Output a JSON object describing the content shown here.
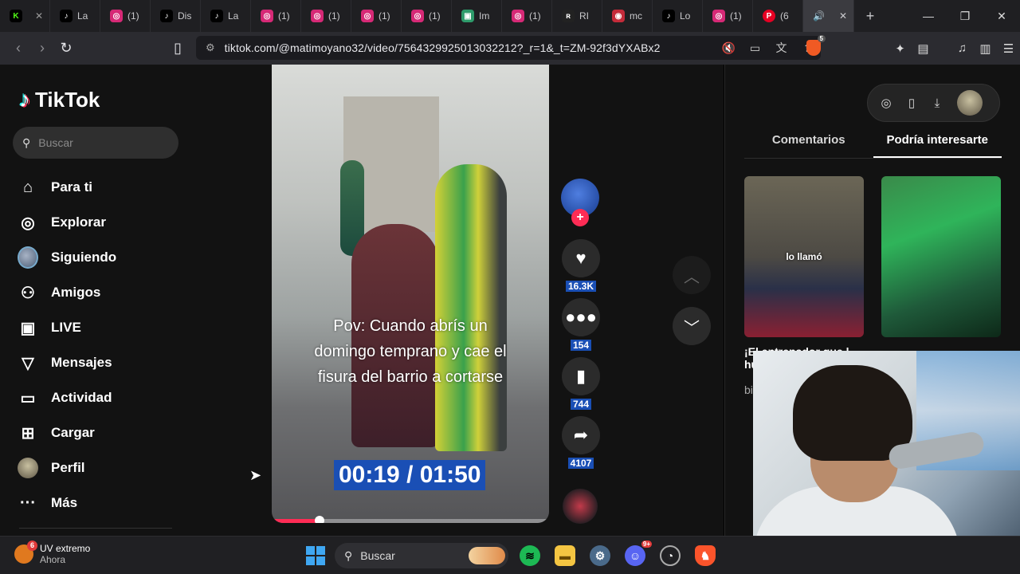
{
  "browser": {
    "tabs": [
      {
        "label": "",
        "icon": "kick-icon",
        "color": "#53fc18"
      },
      {
        "label": "La",
        "icon": "tiktok-icon",
        "color": "#000000"
      },
      {
        "label": "(1)",
        "icon": "instagram-icon",
        "color": "#d62976"
      },
      {
        "label": "Dis",
        "icon": "tiktok-icon",
        "color": "#000000"
      },
      {
        "label": "La",
        "icon": "tiktok-icon",
        "color": "#000000"
      },
      {
        "label": "(1)",
        "icon": "instagram-icon",
        "color": "#d62976"
      },
      {
        "label": "(1)",
        "icon": "instagram-icon",
        "color": "#d62976"
      },
      {
        "label": "(1)",
        "icon": "instagram-icon",
        "color": "#d62976"
      },
      {
        "label": "(1)",
        "icon": "instagram-icon",
        "color": "#d62976"
      },
      {
        "label": "Im",
        "icon": "image-icon",
        "color": "#2e9b6b"
      },
      {
        "label": "(1)",
        "icon": "instagram-icon",
        "color": "#d62976"
      },
      {
        "label": "RI",
        "icon": "rhythm-icon",
        "color": "#222222"
      },
      {
        "label": "mc",
        "icon": "target-icon",
        "color": "#c42b3a"
      },
      {
        "label": "Lo",
        "icon": "tiktok-icon",
        "color": "#000000"
      },
      {
        "label": "(1)",
        "icon": "instagram-icon",
        "color": "#d62976"
      },
      {
        "label": "(6",
        "icon": "pinterest-icon",
        "color": "#e60023"
      }
    ],
    "url": "tiktok.com/@matimoyano32/video/7564329925013032212?_r=1&_t=ZM-92f3dYXABx2",
    "shield_count": "5"
  },
  "sidebar": {
    "brand": "TikTok",
    "search_placeholder": "Buscar",
    "items": [
      {
        "label": "Para ti",
        "icon": "home-icon"
      },
      {
        "label": "Explorar",
        "icon": "compass-icon"
      },
      {
        "label": "Siguiendo",
        "icon": "following-avatar-icon"
      },
      {
        "label": "Amigos",
        "icon": "friends-icon"
      },
      {
        "label": "LIVE",
        "icon": "live-icon"
      },
      {
        "label": "Mensajes",
        "icon": "messages-icon"
      },
      {
        "label": "Actividad",
        "icon": "activity-icon"
      },
      {
        "label": "Cargar",
        "icon": "upload-icon"
      },
      {
        "label": "Perfil",
        "icon": "profile-avatar-icon"
      },
      {
        "label": "Más",
        "icon": "more-icon"
      }
    ]
  },
  "video": {
    "caption_lines": [
      "Pov: Cuando abrís un",
      "domingo temprano y cae el",
      "fisura del barrio a cortarse"
    ],
    "timer": "00:19 / 01:50",
    "progress": 0.173
  },
  "actions": {
    "likes": "16.3K",
    "comments": "154",
    "saves": "744",
    "shares": "4107"
  },
  "right_panel": {
    "tabs": [
      "Comentarios",
      "Podría interesarte"
    ],
    "active_tab": 1,
    "thumb1_text": "lo llamó",
    "partial_title": "¡El entrenador que l",
    "partial_sub": "hu",
    "partial_author": "bi"
  },
  "taskbar": {
    "notif_title": "UV extremo",
    "notif_sub": "Ahora",
    "notif_badge": "6",
    "search_label": "Buscar",
    "discord_badge": "9+"
  },
  "colors": {
    "accent": "#fe2c55",
    "highlight": "#1a4fb5"
  }
}
